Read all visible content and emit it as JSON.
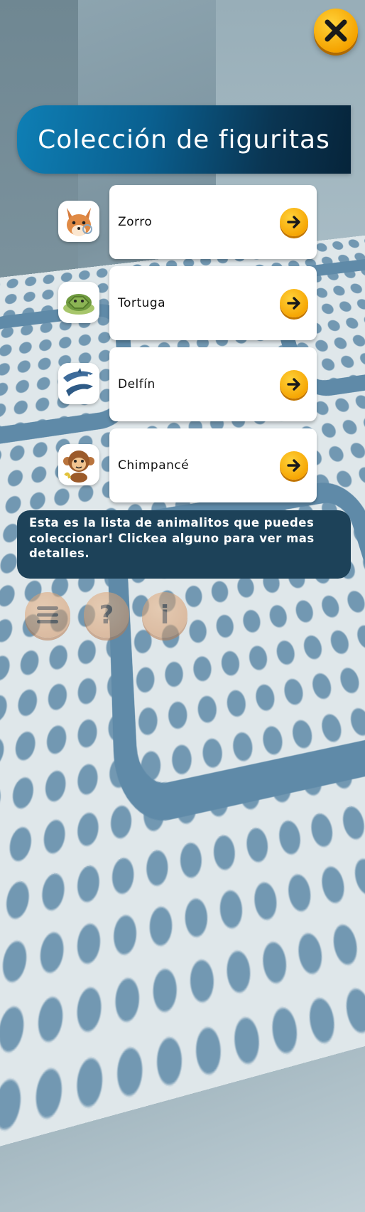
{
  "title": "Colección de figuritas",
  "animals": [
    {
      "name": "Zorro",
      "icon": "fox-icon"
    },
    {
      "name": "Tortuga",
      "icon": "turtle-icon"
    },
    {
      "name": "Delfín",
      "icon": "dolphin-icon"
    },
    {
      "name": "Chimpancé",
      "icon": "chimpanzee-icon"
    }
  ],
  "info_text": "Esta es la lista de animalitos que puedes coleccionar! Clickea alguno para ver mas detalles.",
  "bottom_buttons": {
    "menu": "menu-icon",
    "help": "?",
    "info": "i"
  },
  "colors": {
    "accent": "#f5a300",
    "banner": "#0a3552",
    "info_box": "#1d4259"
  }
}
